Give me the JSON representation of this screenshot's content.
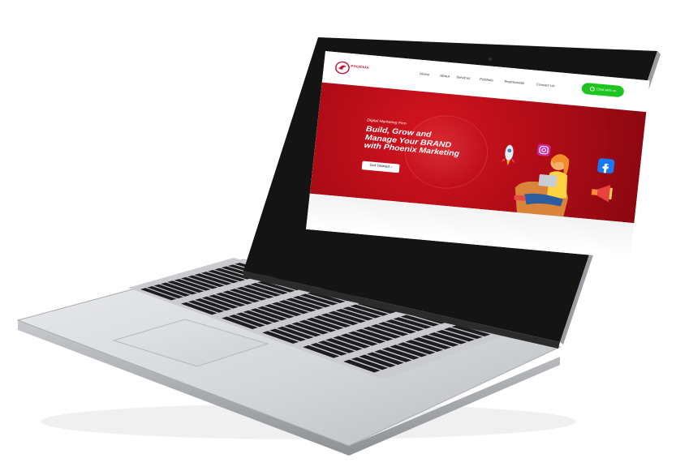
{
  "site": {
    "logo_text": "PHOENIX",
    "nav": [
      "Home",
      "About",
      "Services",
      "Portfolio",
      "Testimonials",
      "Contact Us"
    ],
    "chat_label": "Chat with us",
    "hero": {
      "eyebrow": "Digital Marketing Firm",
      "headline_line1": "Build, Grow and",
      "headline_line2": "Manage Your BRAND",
      "headline_line3": "with Phoenix Marketing",
      "cta_label": "Get Started"
    }
  },
  "colors": {
    "brand_red": "#c8102e",
    "hero_red": "#b40d18",
    "whatsapp_green": "#1ec51e"
  },
  "icons": [
    "phoenix-logo-icon",
    "whatsapp-icon",
    "instagram-icon",
    "facebook-icon",
    "megaphone-icon",
    "rocket-icon",
    "arrow-right-icon"
  ]
}
